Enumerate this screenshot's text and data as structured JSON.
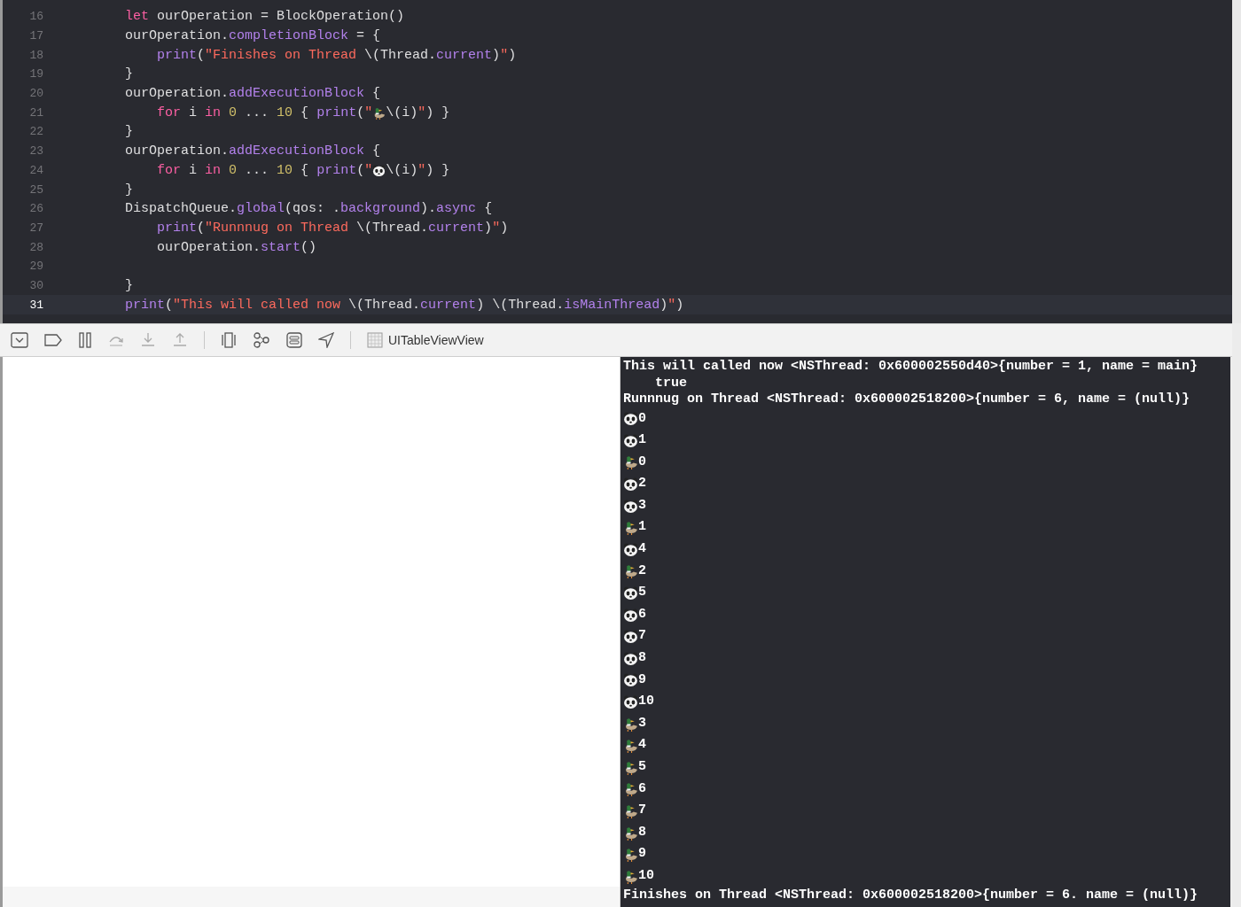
{
  "editor": {
    "lines": [
      {
        "number": "16",
        "current": false,
        "tokens": [
          {
            "kind": "keyword",
            "text": "        let"
          },
          {
            "kind": "plain",
            "text": " ourOperation = BlockOperation()"
          }
        ]
      },
      {
        "number": "17",
        "current": false,
        "tokens": [
          {
            "kind": "plain",
            "text": "        ourOperation."
          },
          {
            "kind": "method",
            "text": "completionBlock"
          },
          {
            "kind": "plain",
            "text": " = {"
          }
        ]
      },
      {
        "number": "18",
        "current": false,
        "tokens": [
          {
            "kind": "method",
            "text": "            print"
          },
          {
            "kind": "plain",
            "text": "("
          },
          {
            "kind": "string",
            "text": "\"Finishes on Thread "
          },
          {
            "kind": "plain",
            "text": "\\(Thread."
          },
          {
            "kind": "method",
            "text": "current"
          },
          {
            "kind": "plain",
            "text": ")"
          },
          {
            "kind": "string",
            "text": "\""
          },
          {
            "kind": "plain",
            "text": ")"
          }
        ]
      },
      {
        "number": "19",
        "current": false,
        "tokens": [
          {
            "kind": "plain",
            "text": "        }"
          }
        ]
      },
      {
        "number": "20",
        "current": false,
        "tokens": [
          {
            "kind": "plain",
            "text": "        ourOperation."
          },
          {
            "kind": "method",
            "text": "addExecutionBlock"
          },
          {
            "kind": "plain",
            "text": " {"
          }
        ]
      },
      {
        "number": "21",
        "current": false,
        "tokens": [
          {
            "kind": "keyword",
            "text": "            for"
          },
          {
            "kind": "plain",
            "text": " i "
          },
          {
            "kind": "keyword",
            "text": "in"
          },
          {
            "kind": "number",
            "text": " 0"
          },
          {
            "kind": "plain",
            "text": " ... "
          },
          {
            "kind": "number",
            "text": "10"
          },
          {
            "kind": "plain",
            "text": " { "
          },
          {
            "kind": "method",
            "text": "print"
          },
          {
            "kind": "plain",
            "text": "("
          },
          {
            "kind": "string",
            "text": "\""
          },
          {
            "kind": "duck"
          },
          {
            "kind": "plain",
            "text": "\\(i)"
          },
          {
            "kind": "string",
            "text": "\""
          },
          {
            "kind": "plain",
            "text": ") }"
          }
        ]
      },
      {
        "number": "22",
        "current": false,
        "tokens": [
          {
            "kind": "plain",
            "text": "        }"
          }
        ]
      },
      {
        "number": "23",
        "current": false,
        "tokens": [
          {
            "kind": "plain",
            "text": "        ourOperation."
          },
          {
            "kind": "method",
            "text": "addExecutionBlock"
          },
          {
            "kind": "plain",
            "text": " {"
          }
        ]
      },
      {
        "number": "24",
        "current": false,
        "tokens": [
          {
            "kind": "keyword",
            "text": "            for"
          },
          {
            "kind": "plain",
            "text": " i "
          },
          {
            "kind": "keyword",
            "text": "in"
          },
          {
            "kind": "number",
            "text": " 0"
          },
          {
            "kind": "plain",
            "text": " ... "
          },
          {
            "kind": "number",
            "text": "10"
          },
          {
            "kind": "plain",
            "text": " { "
          },
          {
            "kind": "method",
            "text": "print"
          },
          {
            "kind": "plain",
            "text": "("
          },
          {
            "kind": "string",
            "text": "\""
          },
          {
            "kind": "panda"
          },
          {
            "kind": "plain",
            "text": "\\(i)"
          },
          {
            "kind": "string",
            "text": "\""
          },
          {
            "kind": "plain",
            "text": ") }"
          }
        ]
      },
      {
        "number": "25",
        "current": false,
        "tokens": [
          {
            "kind": "plain",
            "text": "        }"
          }
        ]
      },
      {
        "number": "26",
        "current": false,
        "tokens": [
          {
            "kind": "plain",
            "text": "        DispatchQueue."
          },
          {
            "kind": "method",
            "text": "global"
          },
          {
            "kind": "plain",
            "text": "(qos: ."
          },
          {
            "kind": "method",
            "text": "background"
          },
          {
            "kind": "plain",
            "text": ")."
          },
          {
            "kind": "method",
            "text": "async"
          },
          {
            "kind": "plain",
            "text": " {"
          }
        ]
      },
      {
        "number": "27",
        "current": false,
        "tokens": [
          {
            "kind": "method",
            "text": "            print"
          },
          {
            "kind": "plain",
            "text": "("
          },
          {
            "kind": "string",
            "text": "\"Runnnug on Thread "
          },
          {
            "kind": "plain",
            "text": "\\(Thread."
          },
          {
            "kind": "method",
            "text": "current"
          },
          {
            "kind": "plain",
            "text": ")"
          },
          {
            "kind": "string",
            "text": "\""
          },
          {
            "kind": "plain",
            "text": ")"
          }
        ]
      },
      {
        "number": "28",
        "current": false,
        "tokens": [
          {
            "kind": "plain",
            "text": "            ourOperation."
          },
          {
            "kind": "method",
            "text": "start"
          },
          {
            "kind": "plain",
            "text": "()"
          }
        ]
      },
      {
        "number": "29",
        "current": false
      },
      {
        "number": "30",
        "current": false,
        "tokens": [
          {
            "kind": "plain",
            "text": "        }"
          }
        ]
      },
      {
        "number": "31",
        "current": true,
        "tokens": [
          {
            "kind": "method",
            "text": "        print"
          },
          {
            "kind": "plain",
            "text": "("
          },
          {
            "kind": "string",
            "text": "\"This will called now "
          },
          {
            "kind": "plain",
            "text": "\\(Thread."
          },
          {
            "kind": "method",
            "text": "current"
          },
          {
            "kind": "plain",
            "text": ") \\(Thread."
          },
          {
            "kind": "method",
            "text": "isMainThread"
          },
          {
            "kind": "plain",
            "text": ")"
          },
          {
            "kind": "string",
            "text": "\""
          },
          {
            "kind": "plain",
            "text": ")"
          }
        ]
      }
    ]
  },
  "debug_bar": {
    "view_name": "UITableViewView"
  },
  "console": [
    {
      "kind": "text",
      "text": "This will called now <NSThread: 0x600002550d40>{number = 1, name = main}"
    },
    {
      "kind": "wrap",
      "text": "true"
    },
    {
      "kind": "text",
      "text": "Runnnug on Thread <NSThread: 0x600002518200>{number = 6, name = (null)}"
    },
    {
      "kind": "panda",
      "text": "0"
    },
    {
      "kind": "panda",
      "text": "1"
    },
    {
      "kind": "duck",
      "text": "0"
    },
    {
      "kind": "panda",
      "text": "2"
    },
    {
      "kind": "panda",
      "text": "3"
    },
    {
      "kind": "duck",
      "text": "1"
    },
    {
      "kind": "panda",
      "text": "4"
    },
    {
      "kind": "duck",
      "text": "2"
    },
    {
      "kind": "panda",
      "text": "5"
    },
    {
      "kind": "panda",
      "text": "6"
    },
    {
      "kind": "panda",
      "text": "7"
    },
    {
      "kind": "panda",
      "text": "8"
    },
    {
      "kind": "panda",
      "text": "9"
    },
    {
      "kind": "panda",
      "text": "10"
    },
    {
      "kind": "duck",
      "text": "3"
    },
    {
      "kind": "duck",
      "text": "4"
    },
    {
      "kind": "duck",
      "text": "5"
    },
    {
      "kind": "duck",
      "text": "6"
    },
    {
      "kind": "duck",
      "text": "7"
    },
    {
      "kind": "duck",
      "text": "8"
    },
    {
      "kind": "duck",
      "text": "9"
    },
    {
      "kind": "duck",
      "text": "10"
    },
    {
      "kind": "text",
      "text": "Finishes on Thread <NSThread: 0x600002518200>{number = 6. name = (null)}"
    }
  ]
}
